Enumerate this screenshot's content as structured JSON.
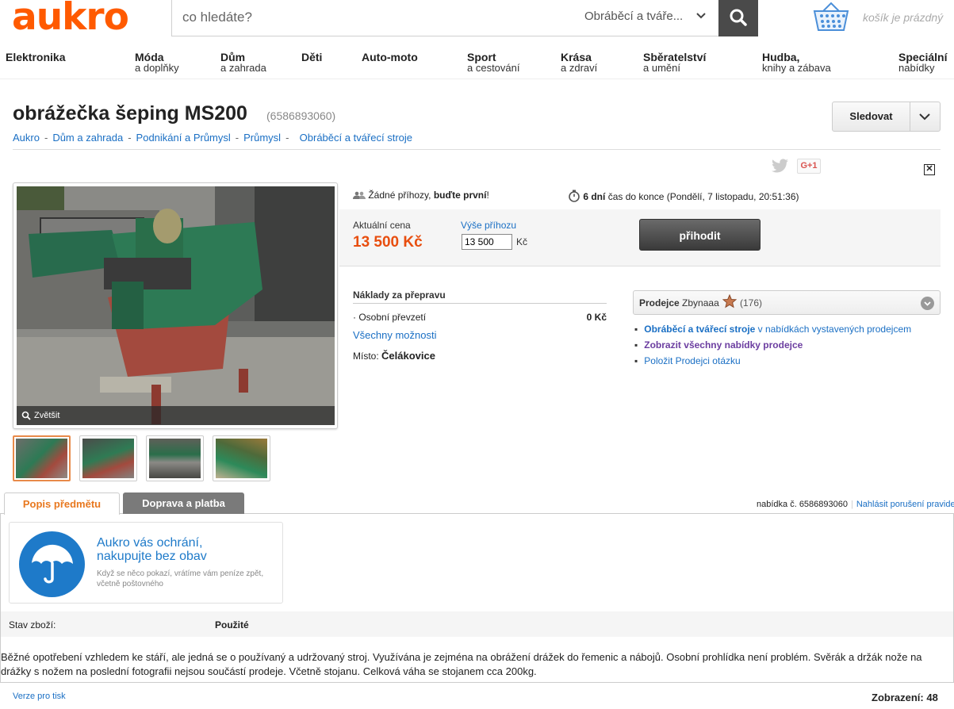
{
  "header": {
    "logo": "aukro",
    "search_placeholder": "co hledáte?",
    "search_category": "Obráběcí a tváře...",
    "cart_text": "košík je prázdný"
  },
  "categories": [
    {
      "main": "Elektronika",
      "sub": ""
    },
    {
      "main": "Móda",
      "sub": "a doplňky"
    },
    {
      "main": "Dům",
      "sub": "a zahrada"
    },
    {
      "main": "Děti",
      "sub": ""
    },
    {
      "main": "Auto-moto",
      "sub": ""
    },
    {
      "main": "Sport",
      "sub": "a cestování"
    },
    {
      "main": "Krása",
      "sub": "a zdraví"
    },
    {
      "main": "Sběratelství",
      "sub": "a umění"
    },
    {
      "main": "Hudba,",
      "sub": "knihy a zábava"
    },
    {
      "main": "Speciální",
      "sub": "nabídky"
    }
  ],
  "item": {
    "title": "obrážečka šeping MS200",
    "id": "(6586893060)",
    "follow_label": "Sledovat"
  },
  "breadcrumb": [
    "Aukro",
    "Dům a zahrada",
    "Podnikání a Průmysl",
    "Průmysl",
    "Obráběcí a tvářecí stroje"
  ],
  "social": {
    "gplus": "G+1"
  },
  "gallery": {
    "zoom_label": "Zvětšit"
  },
  "bid": {
    "bids_text": "Žádné příhozy,",
    "bids_bold": "buďte první",
    "bids_end": "!",
    "time_bold": "6 dní",
    "time_text": "čas do konce (Pondělí, 7 listopadu, 20:51:36)",
    "price_label": "Aktuální cena",
    "price": "13 500 Kč",
    "increment_label": "Výše příhozu",
    "increment_value": "13 500",
    "increment_unit": "Kč",
    "bid_button": "přihodit"
  },
  "shipping": {
    "title": "Náklady za přepravu",
    "option": "Osobní převzetí",
    "option_price": "0 Kč",
    "all_options": "Všechny možnosti",
    "place_label": "Místo:",
    "place_value": "Čelákovice"
  },
  "seller": {
    "label": "Prodejce",
    "name": "Zbynaaa",
    "rating": "(176)",
    "link1_bold": "Obráběcí a tvářecí stroje",
    "link1_rest": " v nabídkách vystavených prodejcem",
    "link2": "Zobrazit všechny nabídky prodejce",
    "link3": "Položit Prodejci otázku"
  },
  "tabs": {
    "description": "Popis předmětu",
    "shipping": "Doprava a platba",
    "offer_number": "nabídka č. 6586893060",
    "report": "Nahlásit porušení pravidel"
  },
  "protection": {
    "heading_line1": "Aukro vás ochrání,",
    "heading_line2": "nakupujte bez obav",
    "sub_line1": "Když se něco pokazí, vrátíme vám peníze zpět,",
    "sub_line2": "včetně poštovného"
  },
  "condition": {
    "label": "Stav zboží:",
    "value": "Použité"
  },
  "description": "Běžné opotřebení vzhledem ke stáří, ale jedná se o používaný a udržovaný stroj. Využívána je zejména na obrážení drážek do řemenic a nábojů. Osobní prohlídka není problém. Svěrák a držák nože na drážky s nožem na poslední fotografii nejsou součástí prodeje. Včetně stojanu. Celková váha se stojanem cca 200kg.",
  "footer": {
    "print": "Verze pro tisk",
    "views": "Zobrazení: 48"
  },
  "colors": {
    "brand": "#ff5a00",
    "price": "#e84e0f",
    "link": "#1a6fc4",
    "tab_active": "#e8781f"
  }
}
